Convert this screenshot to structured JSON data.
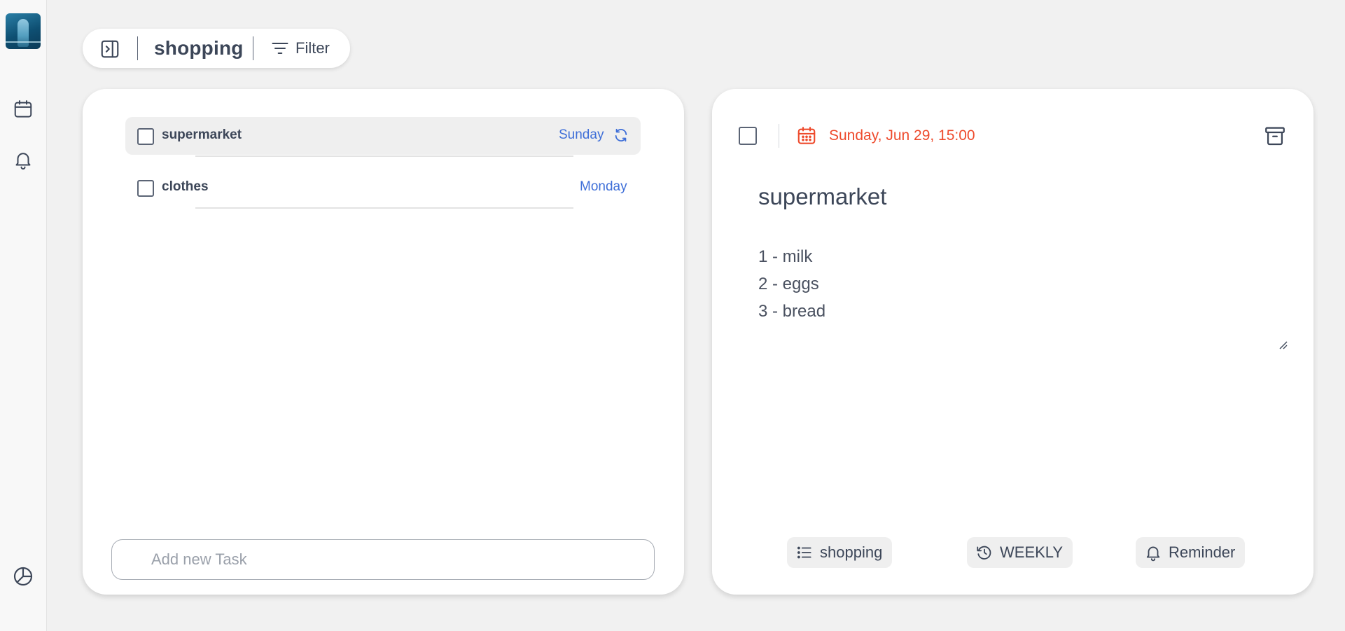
{
  "header": {
    "list_name": "shopping",
    "filter_label": "Filter"
  },
  "sidebar": {
    "icons": [
      "calendar-icon",
      "bell-icon",
      "pie-chart-icon"
    ]
  },
  "tasks": [
    {
      "name": "supermarket",
      "date": "Sunday",
      "repeats": true,
      "selected": true
    },
    {
      "name": "clothes",
      "date": "Monday",
      "repeats": false,
      "selected": false
    }
  ],
  "add_task": {
    "placeholder": "Add new Task"
  },
  "detail": {
    "due": "Sunday, Jun 29, 15:00",
    "title": "supermarket",
    "notes": [
      "1 - milk",
      "2 - eggs",
      "3 - bread"
    ],
    "chips": {
      "list": "shopping",
      "repeat": "WEEKLY",
      "reminder": "Reminder"
    }
  },
  "colors": {
    "accent_blue": "#3f6fd8",
    "due_red": "#ee4a2c",
    "text": "#3c4658",
    "background": "#f1f1f1"
  }
}
